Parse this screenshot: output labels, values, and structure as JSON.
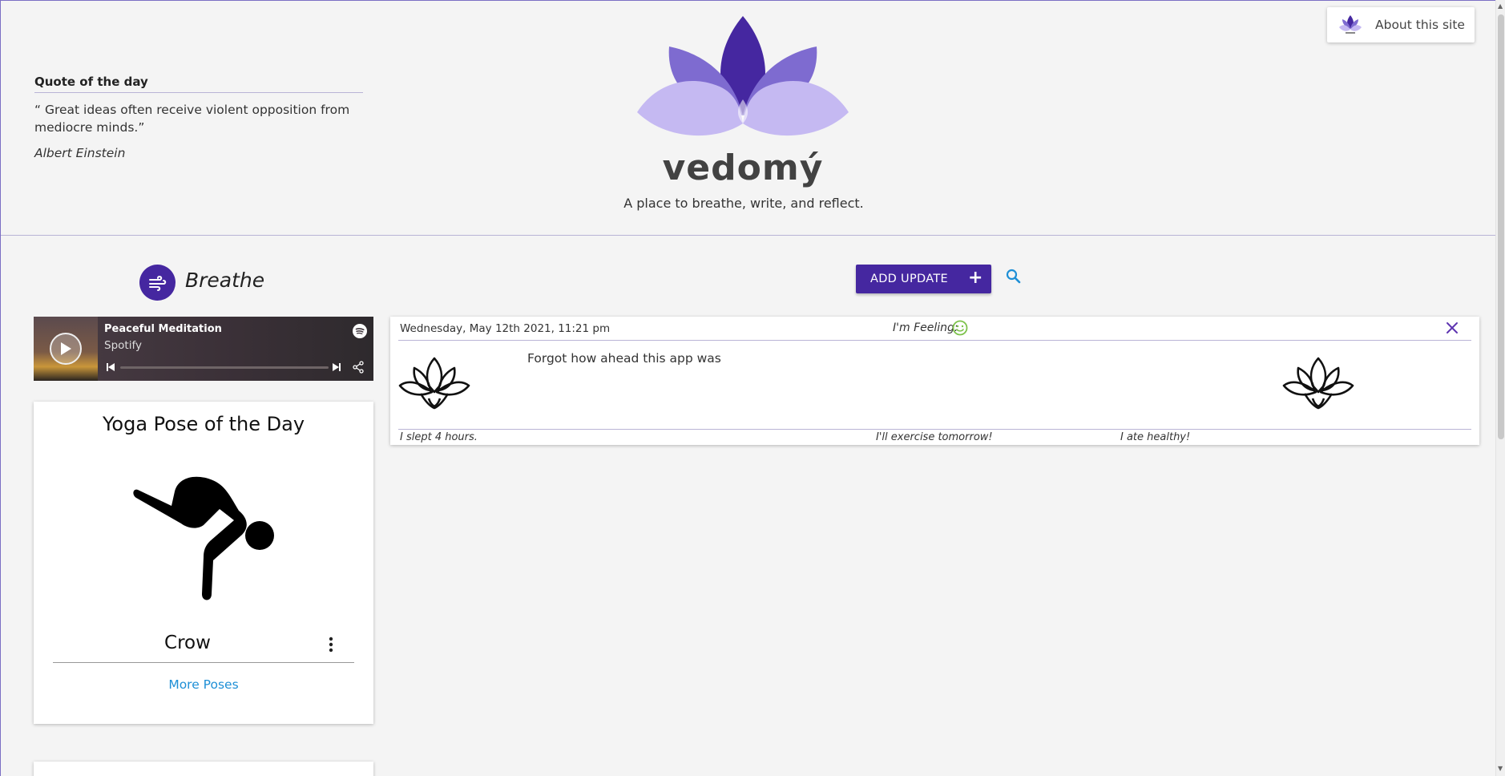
{
  "quote": {
    "title": "Quote of the day",
    "text": "“ Great ideas often receive violent opposition from mediocre minds.”",
    "author": "Albert Einstein"
  },
  "brand": {
    "name": "vedomý",
    "tagline": "A place to breathe, write, and reflect.",
    "colors": {
      "dark": "#4527a0",
      "mid": "#7e6bd0",
      "light": "#c5b9f2"
    }
  },
  "about": {
    "label": "About this site",
    "icon": "lotus-logo-icon"
  },
  "breathe": {
    "label": "Breathe",
    "icon": "wind-icon"
  },
  "player": {
    "title": "Peaceful Meditation",
    "artist": "Spotify",
    "icons": [
      "play-icon",
      "spotify-icon",
      "previous-icon",
      "next-icon",
      "share-icon"
    ]
  },
  "yoga": {
    "card_title": "Yoga Pose of the Day",
    "pose": "Crow",
    "more_link": "More Poses"
  },
  "toolbar": {
    "add_update": "ADD UPDATE",
    "add_icon": "+"
  },
  "entry": {
    "date": "Wednesday, May 12th 2021, 11:21 pm",
    "feeling_label": "I'm Feeling:",
    "feeling_icon": "smiley-icon",
    "text": "Forgot how ahead this app was",
    "sleep": "I slept 4 hours.",
    "exercise": "I'll exercise tomorrow!",
    "diet": "I ate healthy!"
  }
}
